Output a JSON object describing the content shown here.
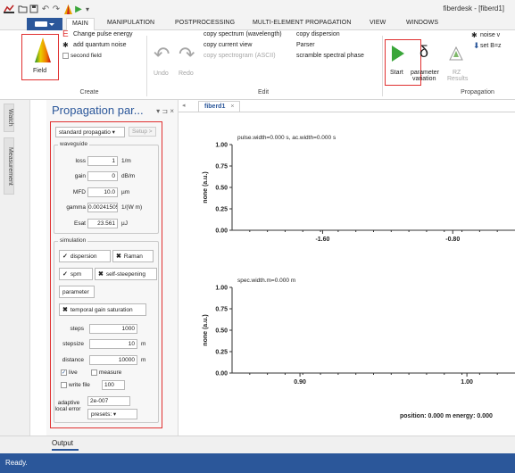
{
  "window": {
    "title": "fiberdesk - [fiberd1]"
  },
  "ribbon_tabs": {
    "file": "",
    "items": [
      "MAIN",
      "MANIPULATION",
      "POSTPROCESSING",
      "MULTI-ELEMENT PROPAGATION",
      "VIEW",
      "WINDOWS"
    ]
  },
  "ribbon": {
    "create": {
      "field_label": "Field",
      "change_pulse_energy": "Change pulse energy",
      "add_quantum_noise": "add quantum noise",
      "second_field": "second field",
      "group_label": "Create"
    },
    "edit": {
      "undo": "Undo",
      "redo": "Redo",
      "copy_spectrum": "copy spectrum (wavelength)",
      "copy_current_view": "copy current view",
      "copy_spectrogram": "copy spectrogram (ASCII)",
      "copy_dispersion": "copy dispersion",
      "parser": "Parser",
      "scramble": "scramble spectral phase",
      "group_label": "Edit"
    },
    "propagation": {
      "start": "Start",
      "parameter_variation_1": "parameter",
      "parameter_variation_2": "variation",
      "rz_results_1": "RZ",
      "rz_results_2": "Results",
      "noise": "noise v",
      "set_b": "set B=z",
      "group_label": "Propagation"
    }
  },
  "side_tabs": {
    "watch": "Watch",
    "measurement": "Measurement"
  },
  "panel": {
    "title": "Propagation par...",
    "controls": "▾ ⊐ ×",
    "model_select": "standard propagatio",
    "setup_button": "Setup >",
    "waveguide": {
      "legend": "waveguide",
      "rows": [
        {
          "label": "loss",
          "value": "1",
          "unit": "1/m"
        },
        {
          "label": "gain",
          "value": "0",
          "unit": "dB/m"
        },
        {
          "label": "MFD",
          "value": "10.0",
          "unit": "µm"
        },
        {
          "label": "gamma",
          "value": "0.00241505",
          "unit": "1/(W m)"
        },
        {
          "label": "Esat",
          "value": "23.561",
          "unit": "µJ"
        }
      ]
    },
    "simulation": {
      "legend": "simulation",
      "dispersion": "dispersion",
      "raman": "Raman",
      "spm": "spm",
      "self_steepening": "self-steepening",
      "parameter": "parameter",
      "temporal_gain_saturation": "temporal gain saturation",
      "rows": [
        {
          "label": "steps",
          "value": "1000",
          "unit": ""
        },
        {
          "label": "stepsize",
          "value": "10",
          "unit": "m"
        },
        {
          "label": "distance",
          "value": "10000",
          "unit": "m"
        }
      ],
      "live": "live",
      "measure": "measure",
      "write_file": "write file",
      "write_file_value": "100",
      "adaptive_label_1": "adaptive",
      "adaptive_label_2": "local error",
      "adaptive_value": "2e-007",
      "presets": "presets:"
    }
  },
  "document": {
    "tab_label": "fiberd1",
    "tab_close": "×",
    "nav": "◂",
    "position_energy": "position: 0.000 m   energy: 0.000"
  },
  "chart_data": [
    {
      "type": "line",
      "title": "pulse.width=0.000 s, ac.width=0.000 s",
      "ylabel": "none (a.u.)",
      "xlabel": "",
      "ylim": [
        0,
        1
      ],
      "yticks": [
        "0.00",
        "0.25",
        "0.50",
        "0.75",
        "1.00"
      ],
      "xticks": [
        "-1.60",
        "-0.80"
      ],
      "series": []
    },
    {
      "type": "line",
      "title": "spec.width.m=0.000 m",
      "ylabel": "none (a.u.)",
      "xlabel": "",
      "ylim": [
        0,
        1
      ],
      "yticks": [
        "0.00",
        "0.25",
        "0.50",
        "0.75",
        "1.00"
      ],
      "xticks": [
        "0.90",
        "1.00"
      ],
      "series": []
    }
  ],
  "output_tab": "Output",
  "status": "Ready.",
  "colors": {
    "accent": "#2b579a",
    "highlight": "#e03030",
    "start_green": "#3aa63a"
  }
}
